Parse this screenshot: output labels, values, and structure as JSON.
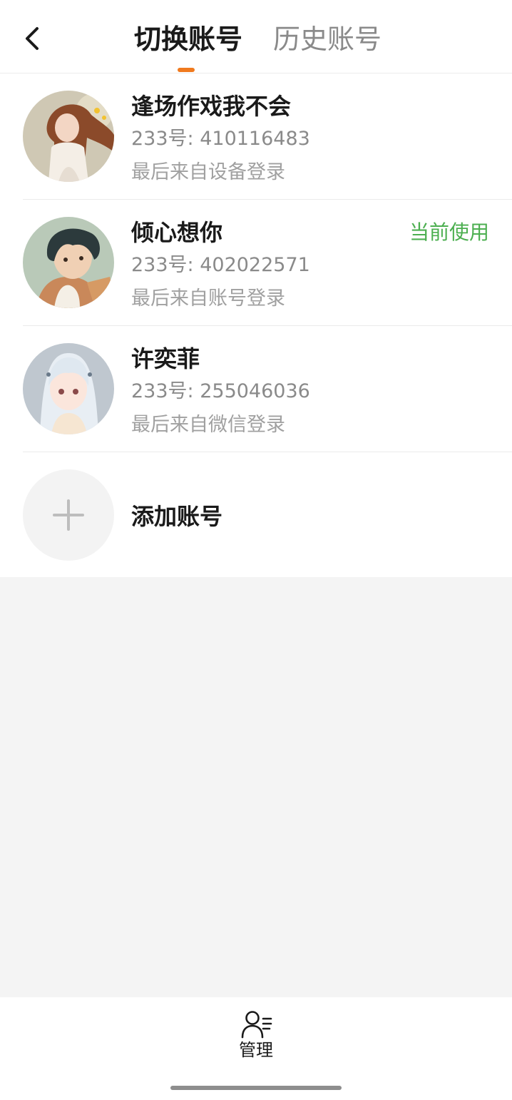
{
  "header": {
    "tabs": [
      {
        "label": "切换账号",
        "active": true
      },
      {
        "label": "历史账号",
        "active": false
      }
    ],
    "accent_color": "#f07a1e"
  },
  "accounts": [
    {
      "name": "逢场作戏我不会",
      "uid": "233号: 410116483",
      "source": "最后来自设备登录",
      "current": false,
      "avatar": "anime-girl-long-hair-avatar"
    },
    {
      "name": "倾心想你",
      "uid": "233号: 402022571",
      "source": "最后来自账号登录",
      "current": true,
      "current_label": "当前使用",
      "avatar": "anime-boy-dark-hair-avatar"
    },
    {
      "name": "许奕菲",
      "uid": "233号: 255046036",
      "source": "最后来自微信登录",
      "current": false,
      "avatar": "anime-girl-white-hair-avatar"
    }
  ],
  "add_account": {
    "label": "添加账号",
    "icon": "plus-icon"
  },
  "bottom": {
    "manage_label": "管理",
    "icon": "user-manage-icon"
  },
  "colors": {
    "current_badge": "#4caf50",
    "background": "#f4f4f4"
  }
}
